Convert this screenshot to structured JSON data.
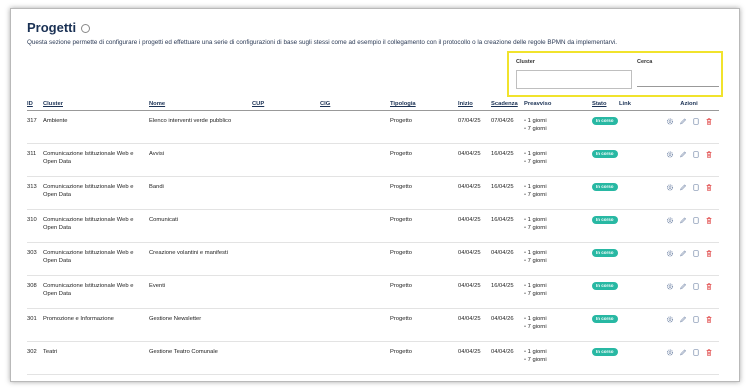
{
  "page": {
    "title": "Progetti",
    "description": "Questa sezione permette di configurare i progetti ed effettuare una serie di configurazioni di base sugli stessi come ad esempio il collegamento con il protocollo o la creazione delle regole BPMN da implementarvi."
  },
  "filters": {
    "cluster_label": "Cluster",
    "search_label": "Cerca",
    "highlight_color": "#f1e32c"
  },
  "table": {
    "headers": {
      "id": "ID",
      "cluster": "Cluster",
      "nome": "Nome",
      "cup": "CUP",
      "cig": "CIG",
      "tipologia": "Tipologia",
      "inizio": "Inizio",
      "scadenza": "Scadenza",
      "preavviso": "Preavviso",
      "stato": "Stato",
      "link": "Link",
      "azioni": "Azioni"
    },
    "rows": [
      {
        "id": "317",
        "cluster": "Ambiente",
        "nome": "Elenco interventi verde pubblico",
        "cup": "",
        "cig": "",
        "tipologia": "Progetto",
        "inizio": "07/04/25",
        "scadenza": "07/04/26",
        "preavviso": [
          "1 giorni",
          "7 giorni"
        ],
        "stato": "In corso"
      },
      {
        "id": "311",
        "cluster": "Comunicazione Istituzionale Web e Open Data",
        "nome": "Avvisi",
        "cup": "",
        "cig": "",
        "tipologia": "Progetto",
        "inizio": "04/04/25",
        "scadenza": "16/04/25",
        "preavviso": [
          "1 giorni",
          "7 giorni"
        ],
        "stato": "In corso"
      },
      {
        "id": "313",
        "cluster": "Comunicazione Istituzionale Web e Open Data",
        "nome": "Bandi",
        "cup": "",
        "cig": "",
        "tipologia": "Progetto",
        "inizio": "04/04/25",
        "scadenza": "16/04/25",
        "preavviso": [
          "1 giorni",
          "7 giorni"
        ],
        "stato": "In corso"
      },
      {
        "id": "310",
        "cluster": "Comunicazione Istituzionale Web e Open Data",
        "nome": "Comunicati",
        "cup": "",
        "cig": "",
        "tipologia": "Progetto",
        "inizio": "04/04/25",
        "scadenza": "16/04/25",
        "preavviso": [
          "1 giorni",
          "7 giorni"
        ],
        "stato": "In corso"
      },
      {
        "id": "303",
        "cluster": "Comunicazione Istituzionale Web e Open Data",
        "nome": "Creazione volantini e manifesti",
        "cup": "",
        "cig": "",
        "tipologia": "Progetto",
        "inizio": "04/04/25",
        "scadenza": "04/04/26",
        "preavviso": [
          "1 giorni",
          "7 giorni"
        ],
        "stato": "In corso"
      },
      {
        "id": "308",
        "cluster": "Comunicazione Istituzionale Web e Open Data",
        "nome": "Eventi",
        "cup": "",
        "cig": "",
        "tipologia": "Progetto",
        "inizio": "04/04/25",
        "scadenza": "16/04/25",
        "preavviso": [
          "1 giorni",
          "7 giorni"
        ],
        "stato": "In corso"
      },
      {
        "id": "301",
        "cluster": "Promozione e Informazione",
        "nome": "Gestione Newsletter",
        "cup": "",
        "cig": "",
        "tipologia": "Progetto",
        "inizio": "04/04/25",
        "scadenza": "04/04/26",
        "preavviso": [
          "1 giorni",
          "7 giorni"
        ],
        "stato": "In corso"
      },
      {
        "id": "302",
        "cluster": "Teatri",
        "nome": "Gestione Teatro Comunale",
        "cup": "",
        "cig": "",
        "tipologia": "Progetto",
        "inizio": "04/04/25",
        "scadenza": "04/04/26",
        "preavviso": [
          "1 giorni",
          "7 giorni"
        ],
        "stato": "In corso"
      }
    ],
    "actions": [
      "gear-icon",
      "pencil-icon",
      "copy-icon",
      "trash-icon"
    ],
    "badge_color": "#28b8a3",
    "delete_color": "#e04646"
  }
}
